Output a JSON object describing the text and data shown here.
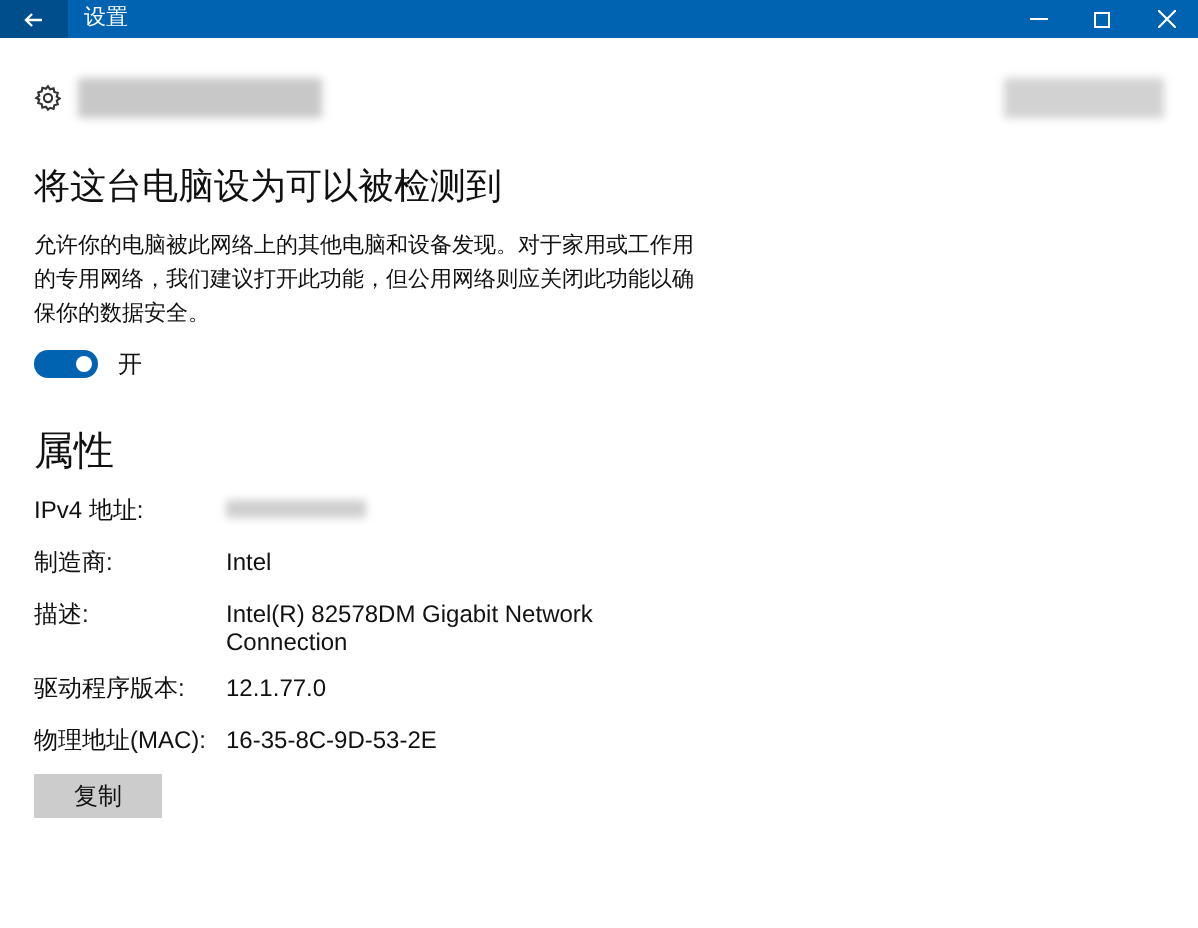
{
  "window": {
    "title": "设置"
  },
  "discoverable": {
    "heading": "将这台电脑设为可以被检测到",
    "description": "允许你的电脑被此网络上的其他电脑和设备发现。对于家用或工作用的专用网络，我们建议打开此功能，但公用网络则应关闭此功能以确保你的数据安全。",
    "toggle": {
      "on": true,
      "label": "开"
    }
  },
  "properties": {
    "heading": "属性",
    "rows": [
      {
        "label": "IPv4 地址:",
        "value_blurred": true
      },
      {
        "label": "制造商:",
        "value": "Intel"
      },
      {
        "label": "描述:",
        "value": "Intel(R) 82578DM Gigabit Network Connection"
      },
      {
        "label": "驱动程序版本:",
        "value": "12.1.77.0"
      },
      {
        "label": "物理地址(MAC):",
        "value": "16-35-8C-9D-53-2E"
      }
    ],
    "copy_button": "复制"
  }
}
